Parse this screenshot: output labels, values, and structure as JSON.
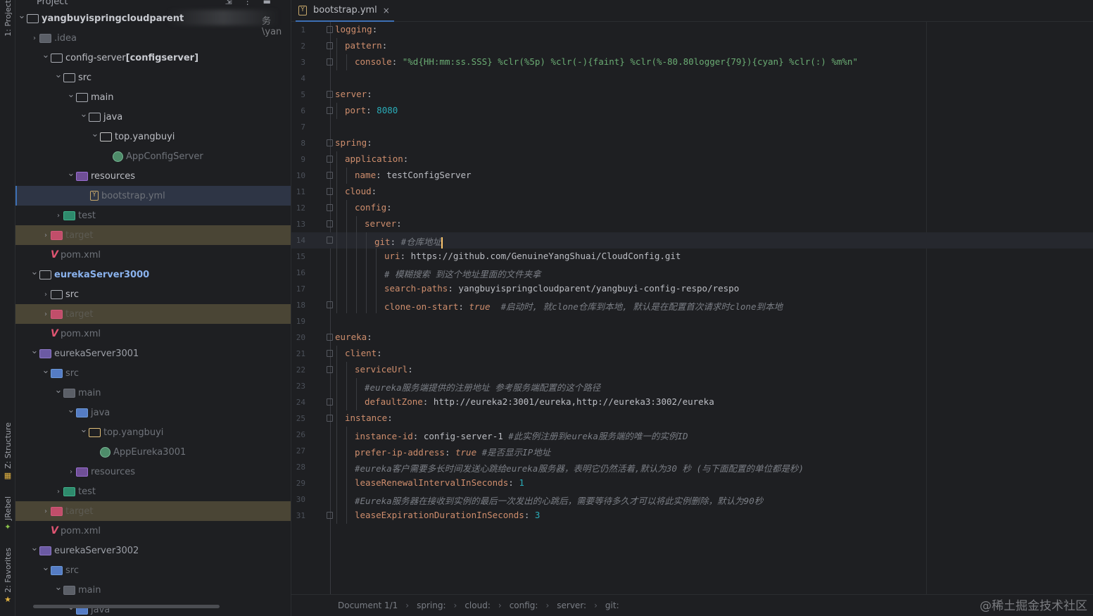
{
  "tool_windows": {
    "project": "1: Project",
    "structure": "Z: Structure",
    "jrebel": "JRebel",
    "favorites": "2: Favorites"
  },
  "project_panel": {
    "title": "Project",
    "blurred_path_tail": "务\\yan",
    "tree": [
      {
        "label": "yangbuyispringcloudparent",
        "icon": "folder-icon",
        "style": "b",
        "arrow": "open"
      },
      {
        "label": ".idea",
        "icon": "folder-dim-icon",
        "style": "dim",
        "arrow": "closed"
      },
      {
        "label": "config-server",
        "suffix": " [configserver]",
        "icon": "folder-icon",
        "style": "normal",
        "arrow": "open"
      },
      {
        "label": "src",
        "icon": "folder-icon",
        "style": "normal",
        "arrow": "open"
      },
      {
        "label": "main",
        "icon": "folder-icon",
        "style": "normal",
        "arrow": "open"
      },
      {
        "label": "java",
        "icon": "folder-icon",
        "style": "normal",
        "arrow": "open"
      },
      {
        "label": "top.yangbuyi",
        "icon": "package-icon",
        "style": "normal",
        "arrow": "open"
      },
      {
        "label": "AppConfigServer",
        "icon": "spring-class-icon",
        "style": "dim",
        "arrow": "none"
      },
      {
        "label": "resources",
        "icon": "resources-folder-icon",
        "style": "normal",
        "arrow": "open"
      },
      {
        "label": "bootstrap.yml",
        "icon": "yaml-file-icon",
        "style": "dim",
        "arrow": "none",
        "selected": true
      },
      {
        "label": "test",
        "icon": "test-folder-icon",
        "style": "dim",
        "arrow": "closed"
      },
      {
        "label": "target",
        "icon": "excluded-folder-icon",
        "style": "ghost",
        "arrow": "closed",
        "highlight": true
      },
      {
        "label": "pom.xml",
        "icon": "maven-icon",
        "style": "dim",
        "arrow": "none"
      },
      {
        "label": "eurekaServer3000",
        "icon": "folder-icon",
        "style": "blue",
        "arrow": "open"
      },
      {
        "label": "src",
        "icon": "folder-icon",
        "style": "normal",
        "arrow": "closed"
      },
      {
        "label": "target",
        "icon": "excluded-folder-icon",
        "style": "ghost",
        "arrow": "closed",
        "highlight": true
      },
      {
        "label": "pom.xml",
        "icon": "maven-icon",
        "style": "dim",
        "arrow": "none"
      },
      {
        "label": "eurekaServer3001",
        "icon": "module-folder-icon",
        "style": "mod",
        "arrow": "open"
      },
      {
        "label": "src",
        "icon": "source-folder-icon",
        "style": "dim",
        "arrow": "open"
      },
      {
        "label": "main",
        "icon": "folder-dim-icon",
        "style": "dim",
        "arrow": "open"
      },
      {
        "label": "java",
        "icon": "source-folder-icon",
        "style": "dim",
        "arrow": "open"
      },
      {
        "label": "top.yangbuyi",
        "icon": "package-yellow-icon",
        "style": "dim",
        "arrow": "open"
      },
      {
        "label": "AppEureka3001",
        "icon": "spring-class-icon",
        "style": "dim",
        "arrow": "none"
      },
      {
        "label": "resources",
        "icon": "resources-folder-icon",
        "style": "dim",
        "arrow": "closed"
      },
      {
        "label": "test",
        "icon": "test-folder-icon",
        "style": "dim",
        "arrow": "closed"
      },
      {
        "label": "target",
        "icon": "excluded-folder-icon",
        "style": "ghost",
        "arrow": "closed",
        "highlight": true
      },
      {
        "label": "pom.xml",
        "icon": "maven-icon",
        "style": "dim",
        "arrow": "none"
      },
      {
        "label": "eurekaServer3002",
        "icon": "module-folder-icon",
        "style": "mod",
        "arrow": "open"
      },
      {
        "label": "src",
        "icon": "source-folder-icon",
        "style": "dim",
        "arrow": "open"
      },
      {
        "label": "main",
        "icon": "folder-dim-icon",
        "style": "dim",
        "arrow": "open"
      },
      {
        "label": "java",
        "icon": "source-folder-icon",
        "style": "dim",
        "arrow": "open"
      }
    ]
  },
  "editor": {
    "tab": {
      "name": "bootstrap.yml",
      "close": "×"
    },
    "lines": [
      {
        "n": "1",
        "ind": 0,
        "fold": true,
        "seg": [
          [
            "k",
            "logging"
          ],
          [
            "p",
            ":"
          ]
        ]
      },
      {
        "n": "2",
        "ind": 1,
        "fold": true,
        "seg": [
          [
            "k",
            "pattern"
          ],
          [
            "p",
            ":"
          ]
        ]
      },
      {
        "n": "3",
        "ind": 2,
        "fold": true,
        "seg": [
          [
            "k",
            "console"
          ],
          [
            "p",
            ": "
          ],
          [
            "s",
            "\"%d{HH:mm:ss.SSS} %clr(%5p) %clr(-){faint} %clr(%-80.80logger{79}){cyan} %clr(:) %m%n\""
          ]
        ]
      },
      {
        "n": "4",
        "ind": 0,
        "fold": false,
        "seg": []
      },
      {
        "n": "5",
        "ind": 0,
        "fold": true,
        "seg": [
          [
            "k",
            "server"
          ],
          [
            "p",
            ":"
          ]
        ]
      },
      {
        "n": "6",
        "ind": 1,
        "fold": true,
        "seg": [
          [
            "k",
            "port"
          ],
          [
            "p",
            ": "
          ],
          [
            "n",
            "8080"
          ]
        ]
      },
      {
        "n": "7",
        "ind": 0,
        "fold": false,
        "seg": []
      },
      {
        "n": "8",
        "ind": 0,
        "fold": true,
        "seg": [
          [
            "k",
            "spring"
          ],
          [
            "p",
            ":"
          ]
        ]
      },
      {
        "n": "9",
        "ind": 1,
        "fold": true,
        "seg": [
          [
            "k",
            "application"
          ],
          [
            "p",
            ":"
          ]
        ]
      },
      {
        "n": "10",
        "ind": 2,
        "fold": true,
        "seg": [
          [
            "k",
            "name"
          ],
          [
            "p",
            ": "
          ],
          [
            "v",
            "testConfigServer"
          ]
        ]
      },
      {
        "n": "11",
        "ind": 1,
        "fold": true,
        "seg": [
          [
            "k",
            "cloud"
          ],
          [
            "p",
            ":"
          ]
        ]
      },
      {
        "n": "12",
        "ind": 2,
        "fold": true,
        "seg": [
          [
            "k",
            "config"
          ],
          [
            "p",
            ":"
          ]
        ]
      },
      {
        "n": "13",
        "ind": 3,
        "fold": true,
        "seg": [
          [
            "k",
            "server"
          ],
          [
            "p",
            ":"
          ]
        ]
      },
      {
        "n": "14",
        "ind": 4,
        "fold": true,
        "cur": true,
        "seg": [
          [
            "k",
            "git"
          ],
          [
            "p",
            ": "
          ],
          [
            "c",
            "#仓库地址"
          ]
        ]
      },
      {
        "n": "15",
        "ind": 5,
        "fold": false,
        "seg": [
          [
            "k",
            "uri"
          ],
          [
            "p",
            ": "
          ],
          [
            "v",
            "https://github.com/GenuineYangShuai/CloudConfig.git"
          ]
        ]
      },
      {
        "n": "16",
        "ind": 5,
        "fold": false,
        "seg": [
          [
            "c",
            "# 模糊搜索 到这个地址里面的文件夹拿"
          ]
        ]
      },
      {
        "n": "17",
        "ind": 5,
        "fold": false,
        "seg": [
          [
            "k",
            "search-paths"
          ],
          [
            "p",
            ": "
          ],
          [
            "v",
            "yangbuyispringcloudparent/yangbuyi-config-respo/respo"
          ]
        ]
      },
      {
        "n": "18",
        "ind": 5,
        "fold": true,
        "seg": [
          [
            "k",
            "clone-on-start"
          ],
          [
            "p",
            ": "
          ],
          [
            "i",
            "true"
          ],
          [
            "p",
            "  "
          ],
          [
            "c",
            "#启动时, 就clone仓库到本地, 默认是在配置首次请求时clone到本地"
          ]
        ]
      },
      {
        "n": "19",
        "ind": 0,
        "fold": false,
        "seg": []
      },
      {
        "n": "20",
        "ind": 0,
        "fold": true,
        "seg": [
          [
            "k",
            "eureka"
          ],
          [
            "p",
            ":"
          ]
        ]
      },
      {
        "n": "21",
        "ind": 1,
        "fold": true,
        "seg": [
          [
            "k",
            "client"
          ],
          [
            "p",
            ":"
          ]
        ]
      },
      {
        "n": "22",
        "ind": 2,
        "fold": true,
        "seg": [
          [
            "k",
            "serviceUrl"
          ],
          [
            "p",
            ":"
          ]
        ]
      },
      {
        "n": "23",
        "ind": 3,
        "fold": false,
        "seg": [
          [
            "c",
            "#eureka服务端提供的注册地址 参考服务端配置的这个路径"
          ]
        ]
      },
      {
        "n": "24",
        "ind": 3,
        "fold": true,
        "seg": [
          [
            "k",
            "defaultZone"
          ],
          [
            "p",
            ": "
          ],
          [
            "v",
            "http://eureka2:3001/eureka,http://eureka3:3002/eureka"
          ]
        ]
      },
      {
        "n": "25",
        "ind": 1,
        "fold": true,
        "seg": [
          [
            "k",
            "instance"
          ],
          [
            "p",
            ":"
          ]
        ]
      },
      {
        "n": "26",
        "ind": 2,
        "fold": false,
        "seg": [
          [
            "k",
            "instance-id"
          ],
          [
            "p",
            ": "
          ],
          [
            "v",
            "config-server-1 "
          ],
          [
            "c",
            "#此实例注册到eureka服务端的唯一的实例ID"
          ]
        ]
      },
      {
        "n": "27",
        "ind": 2,
        "fold": false,
        "seg": [
          [
            "k",
            "prefer-ip-address"
          ],
          [
            "p",
            ": "
          ],
          [
            "i",
            "true"
          ],
          [
            "p",
            " "
          ],
          [
            "c",
            "#是否显示IP地址"
          ]
        ]
      },
      {
        "n": "28",
        "ind": 2,
        "fold": false,
        "seg": [
          [
            "c",
            "#eureka客户需要多长时间发送心跳给eureka服务器，表明它仍然活着,默认为30 秒 (与下面配置的单位都是秒)"
          ]
        ]
      },
      {
        "n": "29",
        "ind": 2,
        "fold": false,
        "seg": [
          [
            "k",
            "leaseRenewalIntervalInSeconds"
          ],
          [
            "p",
            ": "
          ],
          [
            "n",
            "1"
          ]
        ]
      },
      {
        "n": "30",
        "ind": 2,
        "fold": false,
        "seg": [
          [
            "c",
            "#Eureka服务器在接收到实例的最后一次发出的心跳后，需要等待多久才可以将此实例删除，默认为90秒"
          ]
        ]
      },
      {
        "n": "31",
        "ind": 2,
        "fold": true,
        "seg": [
          [
            "k",
            "leaseExpirationDurationInSeconds"
          ],
          [
            "p",
            ": "
          ],
          [
            "n",
            "3"
          ]
        ]
      }
    ]
  },
  "breadcrumb": [
    "Document 1/1",
    "spring:",
    "cloud:",
    "config:",
    "server:",
    "git:"
  ],
  "breadcrumb_separator": "›",
  "watermark": "@稀土掘金技术社区",
  "colors": {
    "key": "#cf8e6d",
    "string": "#6aab73",
    "number": "#2aacb8",
    "comment": "#7a7e85",
    "selection_bar": "#3d6fb4"
  }
}
